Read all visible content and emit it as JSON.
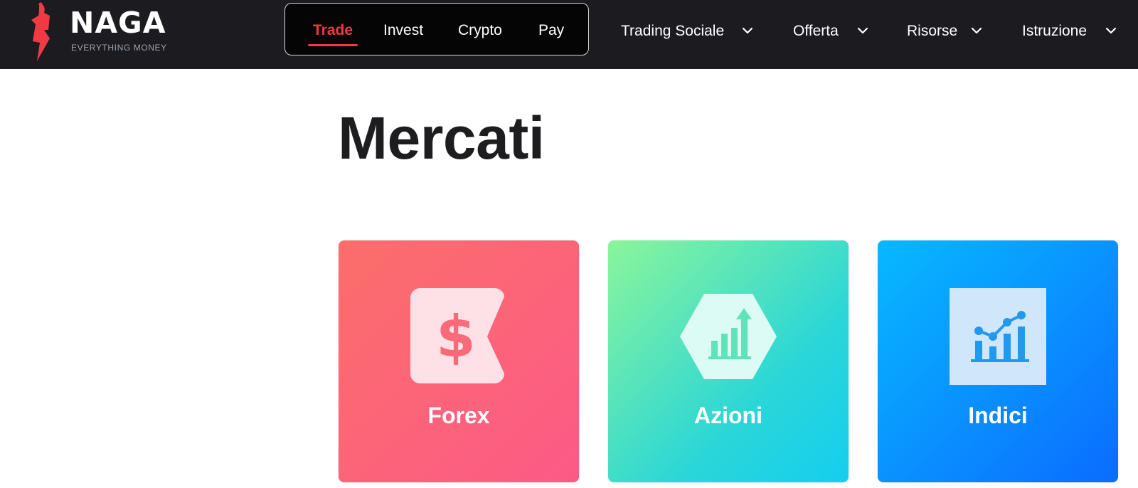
{
  "brand": {
    "name": "NAGA",
    "tagline": "EVERYTHING MONEY",
    "accent_color": "#ef3a43"
  },
  "product_tabs": [
    {
      "label": "Trade",
      "active": true
    },
    {
      "label": "Invest",
      "active": false
    },
    {
      "label": "Crypto",
      "active": false
    },
    {
      "label": "Pay",
      "active": false
    }
  ],
  "nav": [
    {
      "label": "Trading Sociale",
      "icon": "chevron-down-icon"
    },
    {
      "label": "Offerta",
      "icon": "chevron-down-icon"
    },
    {
      "label": "Risorse",
      "icon": "chevron-down-icon"
    },
    {
      "label": "Istruzione",
      "icon": "chevron-down-icon"
    }
  ],
  "page": {
    "title": "Mercati"
  },
  "markets": [
    {
      "label": "Forex",
      "icon": "dollar-tag-icon",
      "gradient": [
        "#fb6e6a",
        "#fc5a87"
      ]
    },
    {
      "label": "Azioni",
      "icon": "stocks-hexagon-icon",
      "gradient": [
        "#8bf59a",
        "#15ceef"
      ]
    },
    {
      "label": "Indici",
      "icon": "index-chart-icon",
      "gradient": [
        "#07b9ff",
        "#0a6cff"
      ]
    }
  ]
}
